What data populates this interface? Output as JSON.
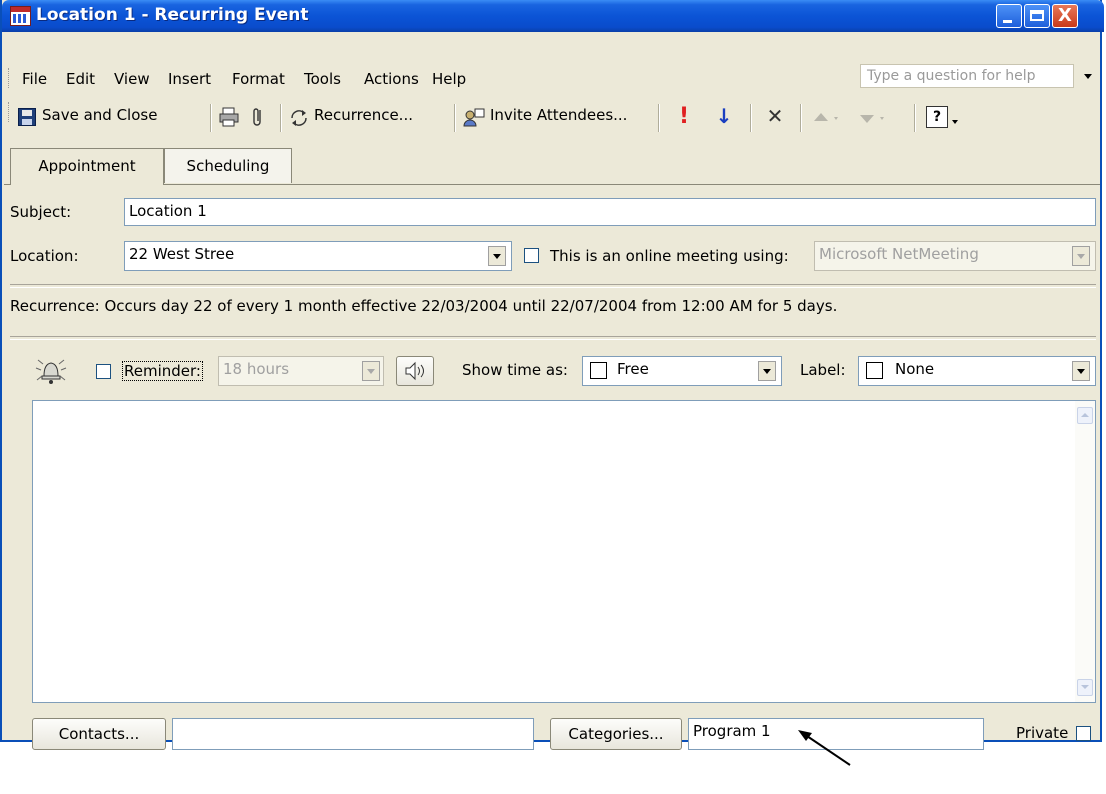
{
  "window": {
    "title": "Location 1 - Recurring Event",
    "close_glyph": "X"
  },
  "menu": {
    "items": [
      "File",
      "Edit",
      "View",
      "Insert",
      "Format",
      "Tools",
      "Actions",
      "Help"
    ],
    "help_placeholder": "Type a question for help"
  },
  "toolbar": {
    "save_close": "Save and Close",
    "recurrence": "Recurrence...",
    "invite": "Invite Attendees...",
    "importance_high_glyph": "!",
    "importance_low_glyph": "↓",
    "delete_glyph": "✕",
    "help_glyph": "?"
  },
  "tabs": [
    "Appointment",
    "Scheduling"
  ],
  "form": {
    "subject_label": "Subject:",
    "subject_value": "Location 1",
    "location_label": "Location:",
    "location_value": "22 West Stree",
    "online_label": "This is an online meeting using:",
    "online_value": "Microsoft NetMeeting",
    "recurrence_text": "Recurrence:  Occurs day 22 of every 1 month effective 22/03/2004 until 22/07/2004 from 12:00 AM for 5 days.",
    "reminder_label": "Reminder:",
    "reminder_value": "18 hours",
    "showtime_label": "Show time as:",
    "showtime_value": "Free",
    "label_label": "Label:",
    "label_value": "None"
  },
  "footer": {
    "contacts_button": "Contacts...",
    "categories_button": "Categories...",
    "categories_value": "Program 1",
    "private_label": "Private"
  },
  "colors": {
    "titlebar": "#0b54d6",
    "window_bg": "#ece9d8",
    "accent_red": "#e02020",
    "accent_blue": "#1a3fc0"
  }
}
